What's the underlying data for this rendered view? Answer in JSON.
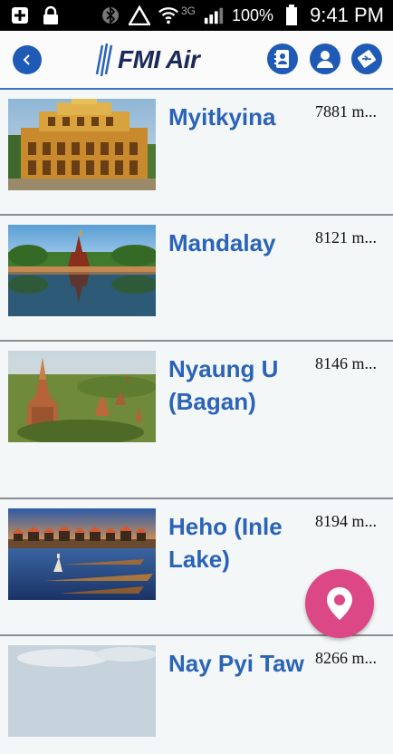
{
  "status_bar": {
    "battery": "100%",
    "time": "9:41 PM",
    "network": "3G",
    "icons": [
      "add-box-icon",
      "lock-icon",
      "bluetooth-icon",
      "warning-icon",
      "wifi-icon",
      "signal-icon",
      "battery-icon"
    ]
  },
  "header": {
    "logo_text": "FMI Air",
    "icons": [
      "back-icon",
      "contacts-icon",
      "profile-icon",
      "ticket-icon"
    ],
    "accent": "#1f5bb6"
  },
  "destinations": [
    {
      "name": "Myitkyina",
      "distance": "7881 m..."
    },
    {
      "name": "Mandalay",
      "distance": "8121 m..."
    },
    {
      "name": "Nyaung U (Bagan)",
      "distance": "8146 m..."
    },
    {
      "name": "Heho (Inle Lake)",
      "distance": "8194 m..."
    },
    {
      "name": "Nay Pyi Taw",
      "distance": "8266 m..."
    }
  ],
  "fab": {
    "icon": "location-pin-icon",
    "color": "#dc4785"
  }
}
